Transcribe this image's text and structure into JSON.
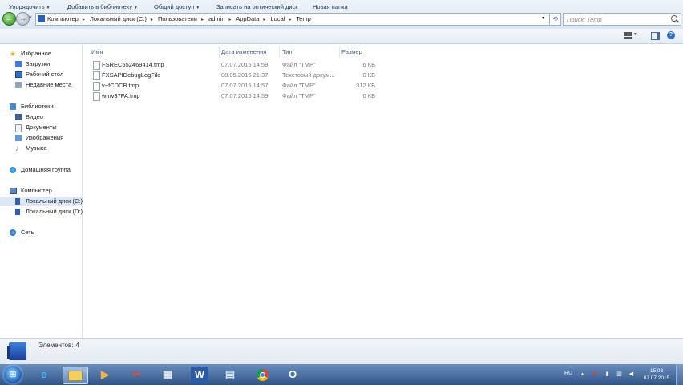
{
  "address": {
    "crumbs": [
      "Компьютер",
      "Локальный диск (C:)",
      "Пользователи",
      "admin",
      "AppData",
      "Local",
      "Temp"
    ],
    "separator": "▸",
    "search_placeholder": "Поиск: Temp"
  },
  "toolbar": {
    "organize": "Упорядочить",
    "add_to_library": "Добавить в библиотеку",
    "share": "Общий доступ",
    "burn": "Записать на оптический диск",
    "new_folder": "Новая папка",
    "caret": "▾"
  },
  "nav": {
    "favorites": "Избранное",
    "downloads": "Загрузки",
    "desktop": "Рабочий стол",
    "recent": "Недавние места",
    "libraries": "Библиотеки",
    "video": "Видео",
    "documents": "Документы",
    "images": "Изображения",
    "music": "Музыка",
    "homegroup": "Домашняя группа",
    "computer": "Компьютер",
    "drive_c": "Локальный диск (C:)",
    "drive_d": "Локальный диск (D:)",
    "network": "Сеть"
  },
  "columns": {
    "name": "Имя",
    "date": "Дата изменения",
    "type": "Тип",
    "size": "Размер"
  },
  "files": [
    {
      "name": "FSREC552469414.tmp",
      "date": "07.07.2015 14:59",
      "type": "Файл \"TMP\"",
      "size": "6 КБ"
    },
    {
      "name": "FXSAPIDebugLogFile",
      "date": "08.05.2015 21:37",
      "type": "Текстовый докум...",
      "size": "0 КБ"
    },
    {
      "name": "v~fCDCB.tmp",
      "date": "07.07.2015 14:57",
      "type": "Файл \"TMP\"",
      "size": "312 КБ"
    },
    {
      "name": "wmv37FA.tmp",
      "date": "07.07.2015 14:59",
      "type": "Файл \"TMP\"",
      "size": "0 КБ"
    }
  ],
  "status": {
    "label": "Элементов:",
    "count": "4"
  },
  "taskbar": {
    "lang": "RU",
    "time": "15:03",
    "date": "07.07.2015"
  }
}
